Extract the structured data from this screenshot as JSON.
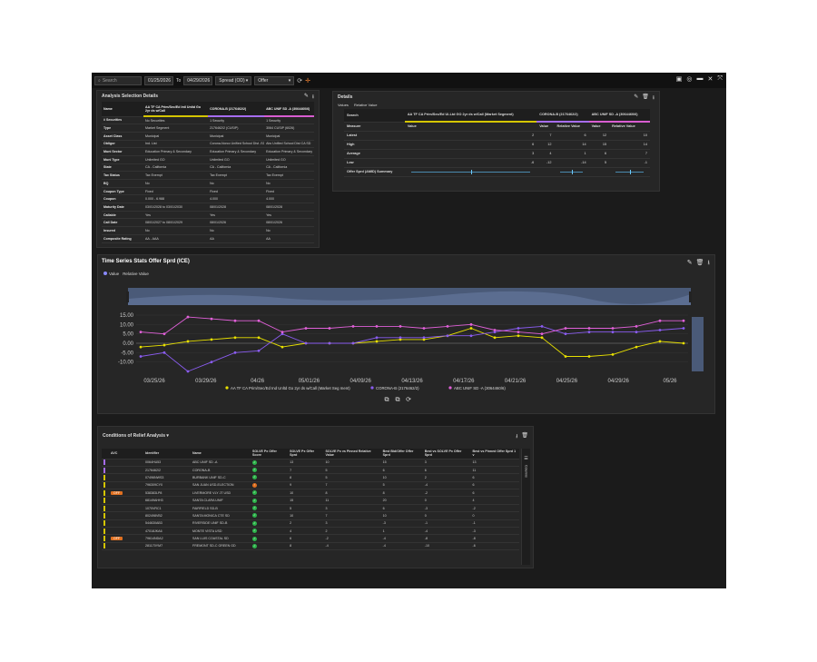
{
  "topbar": {
    "search_placeholder": "Search",
    "date_from": "01/25/2026",
    "to_label": "To",
    "date_to": "04/29/2026",
    "measure": "Spread (OD)",
    "side": "Offer"
  },
  "analysis": {
    "title": "Analysis Selection Details",
    "columns": [
      "Name",
      "AA TF CA Prim/Sec/Ed Intl Unltd Go 2yr ds w/Call",
      "CORONA-B (2176462/2)",
      "ABC UNIF SD -A (3064460/6)"
    ],
    "column_colors": [
      "#d4c500",
      "#a66cf0",
      "#d85dd0"
    ],
    "rows": [
      {
        "label": "# Securities",
        "values": [
          "No Securities",
          "1 Security",
          "1 Security"
        ]
      },
      {
        "label": "Type",
        "values": [
          "Market Segment",
          "2176462/2 (CUSIP)",
          "3064 CUSIP (6026)"
        ]
      },
      {
        "label": "Asset Class",
        "values": [
          "Municipal",
          "Municipal",
          "Municipal"
        ]
      },
      {
        "label": "Obligor",
        "values": [
          "Ind. List",
          "Corona-Norco Unified School Dist -SD-A",
          "Abc Unified School Dist CA SD"
        ]
      },
      {
        "label": "Muni Sector",
        "values": [
          "Education Primary & Secondary",
          "Education Primary & Secondary",
          "Education Primary & Secondary"
        ]
      },
      {
        "label": "Muni Type",
        "values": [
          "Unlimited GO",
          "Unlimited GO",
          "Unlimited GO"
        ]
      },
      {
        "label": "State",
        "values": [
          "CA - California",
          "CA - California",
          "CA - California"
        ]
      },
      {
        "label": "Tax Status",
        "values": [
          "Tax Exempt",
          "Tax Exempt",
          "Tax Exempt"
        ]
      },
      {
        "label": "BQ",
        "values": [
          "No",
          "No",
          "No"
        ]
      },
      {
        "label": "Coupon Type",
        "values": [
          "Fixed",
          "Fixed",
          "Fixed"
        ]
      },
      {
        "label": "Coupon",
        "values": [
          "0.000 - 6.988",
          "4.000",
          "4.000"
        ]
      },
      {
        "label": "Maturity Date",
        "values": [
          "03/01/2028 to 03/01/2030",
          "08/01/2028",
          "08/01/2028"
        ]
      },
      {
        "label": "Callable",
        "values": [
          "Yes",
          "Yes",
          "Yes"
        ]
      },
      {
        "label": "Call Date",
        "values": [
          "08/01/2027 to 08/01/2029",
          "08/01/2026",
          "08/01/2026"
        ]
      },
      {
        "label": "Insured",
        "values": [
          "No",
          "No",
          "No"
        ]
      },
      {
        "label": "Composite Rating",
        "values": [
          "AA - AAA",
          "AA",
          "AA"
        ]
      }
    ]
  },
  "stats": {
    "title": "Details",
    "toggle_value": "Values",
    "toggle_relative": "Relative Value",
    "search_label": "Search",
    "search_values": [
      "AA TF CA Prim/Sec/Ed Ul-Ltd GO 2yr ds w/Call (Market Segment)",
      "CORONA-B (2176462/2)",
      "ABC UNIF SD -A (3064460/6)"
    ],
    "col_headers": [
      "Measure",
      "Value",
      "Value",
      "Relative Value",
      "Value",
      "Relative Value"
    ],
    "rows": [
      {
        "label": "Latest",
        "values": [
          "2",
          "7",
          "6",
          "12",
          "10"
        ]
      },
      {
        "label": "High",
        "values": [
          "6",
          "12",
          "14",
          "15",
          "14"
        ]
      },
      {
        "label": "Average",
        "values": [
          "3",
          "4",
          "1",
          "6",
          "7"
        ]
      },
      {
        "label": "Low",
        "values": [
          "-6",
          "-12",
          "-14",
          "5",
          "-1"
        ]
      }
    ],
    "summary_label": "Offer Sprd (AMID) Summary"
  },
  "timeseries": {
    "title": "Time Series Stats Offer Sprd (ICE)",
    "legend_value": "Value",
    "legend_relative": "Relative Value"
  },
  "chart_data": {
    "type": "line",
    "title": "Time Series Stats Offer Sprd (ICE)",
    "x": [
      "03/21/26",
      "03/24/26",
      "03/25/26",
      "03/27/26",
      "03/29/26",
      "03/31/26",
      "04/01/26",
      "04/03/26",
      "04/05/26",
      "04/07/26",
      "04/09/26",
      "04/11/26",
      "04/13/26",
      "04/15/26",
      "04/17/26",
      "04/19/26",
      "04/21/26",
      "04/23/26",
      "04/25/26",
      "04/27/26",
      "04/29/26",
      "05/01/26",
      "05/04/26",
      "05/06/26"
    ],
    "x_ticks": [
      "03/25/26",
      "03/29/26",
      "04/26",
      "05/01/26",
      "04/09/26",
      "04/13/26",
      "04/17/26",
      "04/21/26",
      "04/25/26",
      "04/29/26",
      "05/26"
    ],
    "ylim": [
      -15,
      15
    ],
    "y_ticks": [
      "15.00",
      "10.00",
      "5.00",
      "0.00",
      "-5.00",
      "-10.00"
    ],
    "series": [
      {
        "name": "AA TF CA Prim/Sec/Ed Ind Unltd Go 2yr ds w/Call (Market Seg ment)",
        "color": "#e8e000",
        "values": [
          -2,
          -1,
          1,
          2,
          3,
          3,
          -2,
          0,
          0,
          0,
          1,
          2,
          2,
          4,
          8,
          3,
          4,
          3,
          -7,
          -7,
          -6,
          -2,
          1,
          0
        ]
      },
      {
        "name": "CORONA-B (2176462/2)",
        "color": "#8a5cf0",
        "values": [
          -7,
          -5,
          -15,
          -10,
          -5,
          -4,
          5,
          0,
          0,
          0,
          3,
          3,
          3,
          4,
          4,
          6,
          8,
          9,
          5,
          6,
          6,
          6,
          7,
          8
        ]
      },
      {
        "name": "ABC UNIF SD -A (3064460/6)",
        "color": "#e060d8",
        "values": [
          6,
          5,
          14,
          13,
          12,
          12,
          6,
          8,
          8,
          9,
          9,
          9,
          8,
          9,
          10,
          7,
          6,
          5,
          8,
          8,
          8,
          9,
          12,
          12
        ]
      }
    ]
  },
  "conditions": {
    "title": "Conditions of Relief Analysis",
    "headers": [
      "",
      "AVC",
      "Identifier",
      "Name",
      "SOLVE Px Offer Score",
      "SOLVE Px Offer Sprd",
      "SOLVE Px vs Pinned Relative Value",
      "Best Bid/Offer Offer Sprd",
      "Best vs SOLVE Px Offer Sprd",
      "Best vs Pinned Offer Sprd 1 v"
    ],
    "side_label": "Columns",
    "rows": [
      {
        "flag": "p",
        "avc": "",
        "id": "0064HU53",
        "name": "ABC UNIF SD -A",
        "status": "ok",
        "v": [
          "13",
          "10",
          "15",
          "3",
          "13"
        ]
      },
      {
        "flag": "p",
        "avc": "",
        "id": "2176462/2",
        "name": "CORONA-B",
        "status": "ok",
        "v": [
          "7",
          "5",
          "6",
          "6",
          "11"
        ]
      },
      {
        "flag": "y",
        "avc": "",
        "id": "07496NWS3",
        "name": "BURBANK UNIF SD-C",
        "status": "ok",
        "v": [
          "8",
          "5",
          "10",
          "2",
          "6"
        ]
      },
      {
        "flag": "y",
        "avc": "",
        "id": "796309CY0",
        "name": "SAN JUAN USD-ELECTION",
        "status": "warn",
        "v": [
          "9",
          "7",
          "5",
          "-4",
          "6"
        ]
      },
      {
        "flag": "y",
        "avc": "OFF",
        "id": "538383LP8",
        "name": "LIVERMORE VLY JT USD",
        "status": "ok",
        "v": [
          "10",
          "8",
          "8",
          "-2",
          "6"
        ]
      },
      {
        "flag": "y",
        "avc": "",
        "id": "68149AHH3",
        "name": "SANTA CLARA UNIF",
        "status": "ok",
        "v": [
          "15",
          "11",
          "20",
          "0",
          "4"
        ]
      },
      {
        "flag": "y",
        "avc": "",
        "id": "1070VRC1",
        "name": "FAIRFIELD SD-B",
        "status": "ok",
        "v": [
          "5",
          "3",
          "6",
          "-3",
          "-2"
        ]
      },
      {
        "flag": "y",
        "avc": "",
        "id": "802498VB2",
        "name": "SANTA MONICA CTE SD",
        "status": "ok",
        "v": [
          "10",
          "7",
          "10",
          "0",
          "0"
        ]
      },
      {
        "flag": "y",
        "avc": "",
        "id": "544630AB3",
        "name": "RIVERSIDE UNIF SD-B",
        "status": "ok",
        "v": [
          "2",
          "3",
          "-3",
          "-1",
          "-1"
        ]
      },
      {
        "flag": "y",
        "avc": "",
        "id": "47018JKA6",
        "name": "MONTE VISTA USD",
        "status": "ok",
        "v": [
          "4",
          "2",
          "1",
          "-4",
          "-3"
        ]
      },
      {
        "flag": "y",
        "avc": "OFF",
        "id": "79614NDA2",
        "name": "SAN LUIS COASTAL SD",
        "status": "ok",
        "v": [
          "6",
          "-2",
          "-4",
          "-8",
          "-8"
        ]
      },
      {
        "flag": "y",
        "avc": "",
        "id": "281170YM7",
        "name": "FREMONT SD-C GREEN GD",
        "status": "ok",
        "v": [
          "8",
          "-4",
          "-4",
          "-10",
          "-6"
        ]
      }
    ]
  }
}
